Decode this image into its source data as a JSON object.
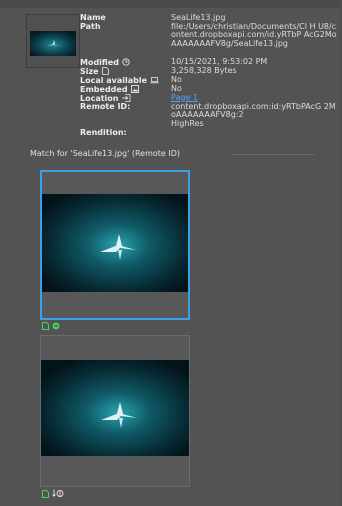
{
  "link_info": {
    "name_label": "Name",
    "name_value": "SeaLife13.jpg",
    "path_label": "Path",
    "path_value": "file:/Users/christian/Documents/Cl H U8/content.dropboxapi.com/id.yRTbP AcG2MoAAAAAAAFV8g/SeaLife13.jpg",
    "modified_label": "Modified",
    "modified_value": "10/15/2021, 9:53:02 PM",
    "size_label": "Size",
    "size_value": "3,258,328 Bytes",
    "local_label": "Local available",
    "local_value": "No",
    "embedded_label": "Embedded",
    "embedded_value": "No",
    "location_label": "Location",
    "location_value": "Page 1",
    "remote_label": "Remote ID:",
    "remote_value": "content.dropboxapi.com:id:yRTbPAcG 2MoAAAAAAAFV8g:2",
    "rendition_label": "Rendition:",
    "rendition_value": "HighRes"
  },
  "match": {
    "header": "Match for 'SeaLife13.jpg' (Remote ID)"
  },
  "icons": {
    "modified": "clock-icon",
    "size": "document-icon",
    "local": "laptop-icon",
    "embedded": "image-icon",
    "location": "goto-page-icon",
    "card1_status": [
      "document-icon",
      "check-circle-icon"
    ],
    "card2_status": [
      "document-icon",
      "download-icon"
    ]
  },
  "colors": {
    "selection": "#3ca0e6",
    "link": "#4aa6ff",
    "status_green": "#4cd35a"
  }
}
